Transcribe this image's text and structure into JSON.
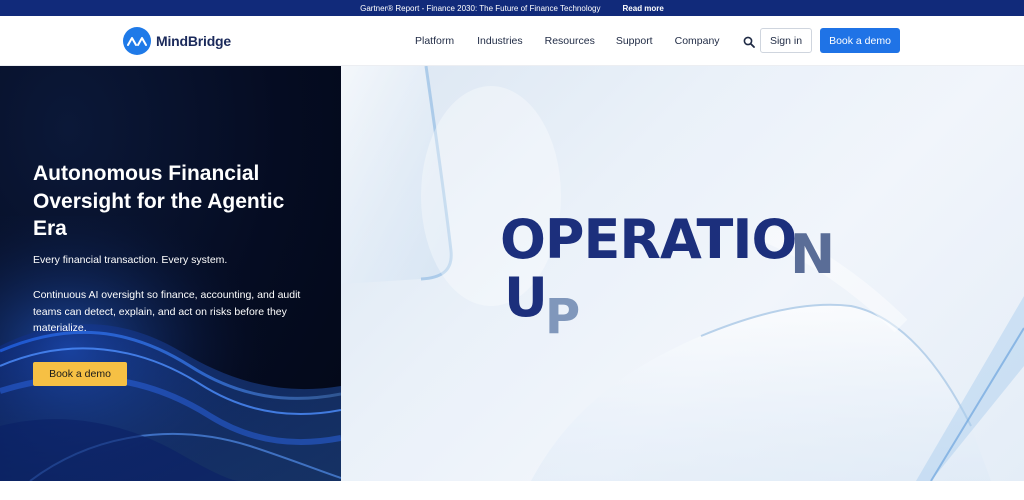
{
  "announcement": {
    "text": "Gartner® Report - Finance 2030: The Future of Finance Technology",
    "link": "Read more"
  },
  "header": {
    "logo_text": "MindBridge",
    "nav": [
      "Platform",
      "Industries",
      "Resources",
      "Support",
      "Company"
    ],
    "sign_in": "Sign in",
    "book_demo": "Book a demo"
  },
  "hero": {
    "title": "Autonomous Financial Oversight for the Agentic Era",
    "subtitle": "Every financial transaction. Every system.",
    "description": "Continuous AI oversight so finance, accounting, and audit teams can detect, explain, and act on risks before they materialize.",
    "cta": "Book a demo"
  },
  "visual": {
    "line1": "OPERATIO",
    "line1_last": "N",
    "line2_first": "U",
    "line2_last": "P"
  },
  "colors": {
    "announce_bg": "#112a7a",
    "primary": "#1f73e6",
    "cta_yellow": "#f6c044",
    "hero_dark": "#050c22",
    "headline_navy": "#1c2f7c"
  }
}
